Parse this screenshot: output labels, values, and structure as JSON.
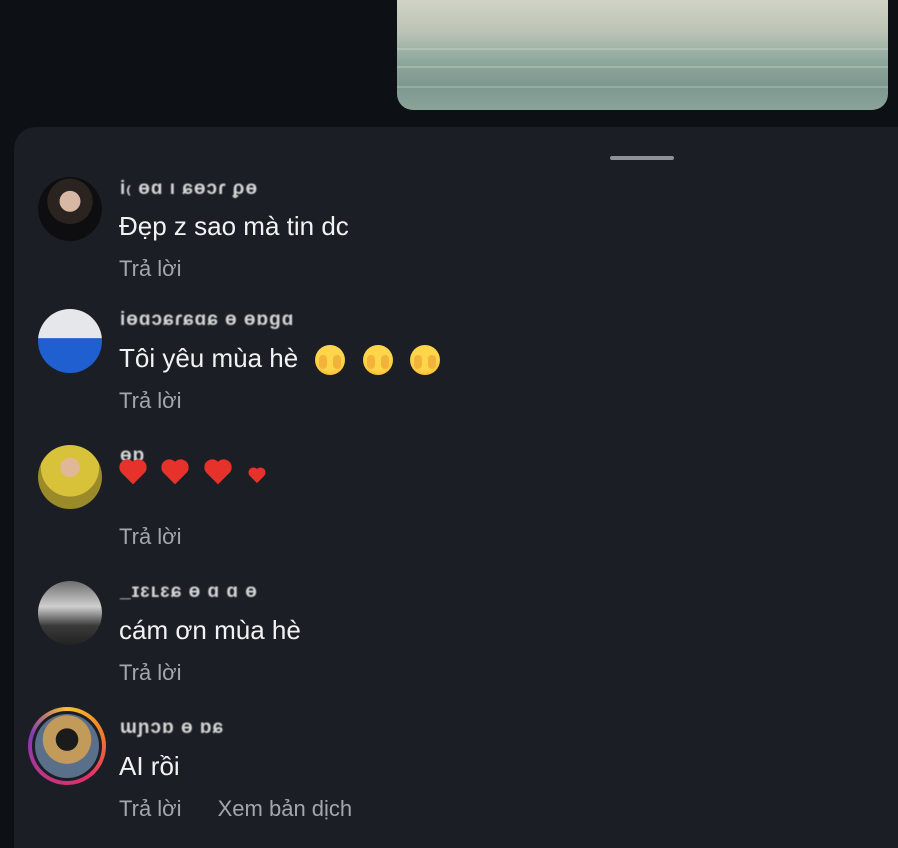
{
  "comments": [
    {
      "username": "i₍ ɵɑ ı ɕɵɔɾ ϼɵ",
      "text": "Đẹp z sao mà tin dc",
      "reply": "Trả lời",
      "has_story": false
    },
    {
      "username": "iɵɑɔɕɾɕɑɕ ɵ ɵɒɡɑ",
      "text": "Tôi yêu mùa hè",
      "emoji": [
        "😱",
        "😱",
        "😱"
      ],
      "reply": "Trả lời",
      "has_story": false
    },
    {
      "username": "ɵɒ",
      "text": "",
      "hearts": 4,
      "reply": "Trả lời",
      "has_story": false
    },
    {
      "username": "_ɪɛʟɛɕ ɵ ɑ ɑ ɵ",
      "text": "cám ơn mùa hè",
      "reply": "Trả lời",
      "has_story": false
    },
    {
      "username": "ɯɲɔɒ ɵ ɒɕ",
      "text": "AI rồi",
      "reply": "Trả lời",
      "translate": "Xem bản dịch",
      "has_story": true
    }
  ],
  "icons": {
    "avatar": "avatar",
    "drag_handle": "drag-handle"
  }
}
